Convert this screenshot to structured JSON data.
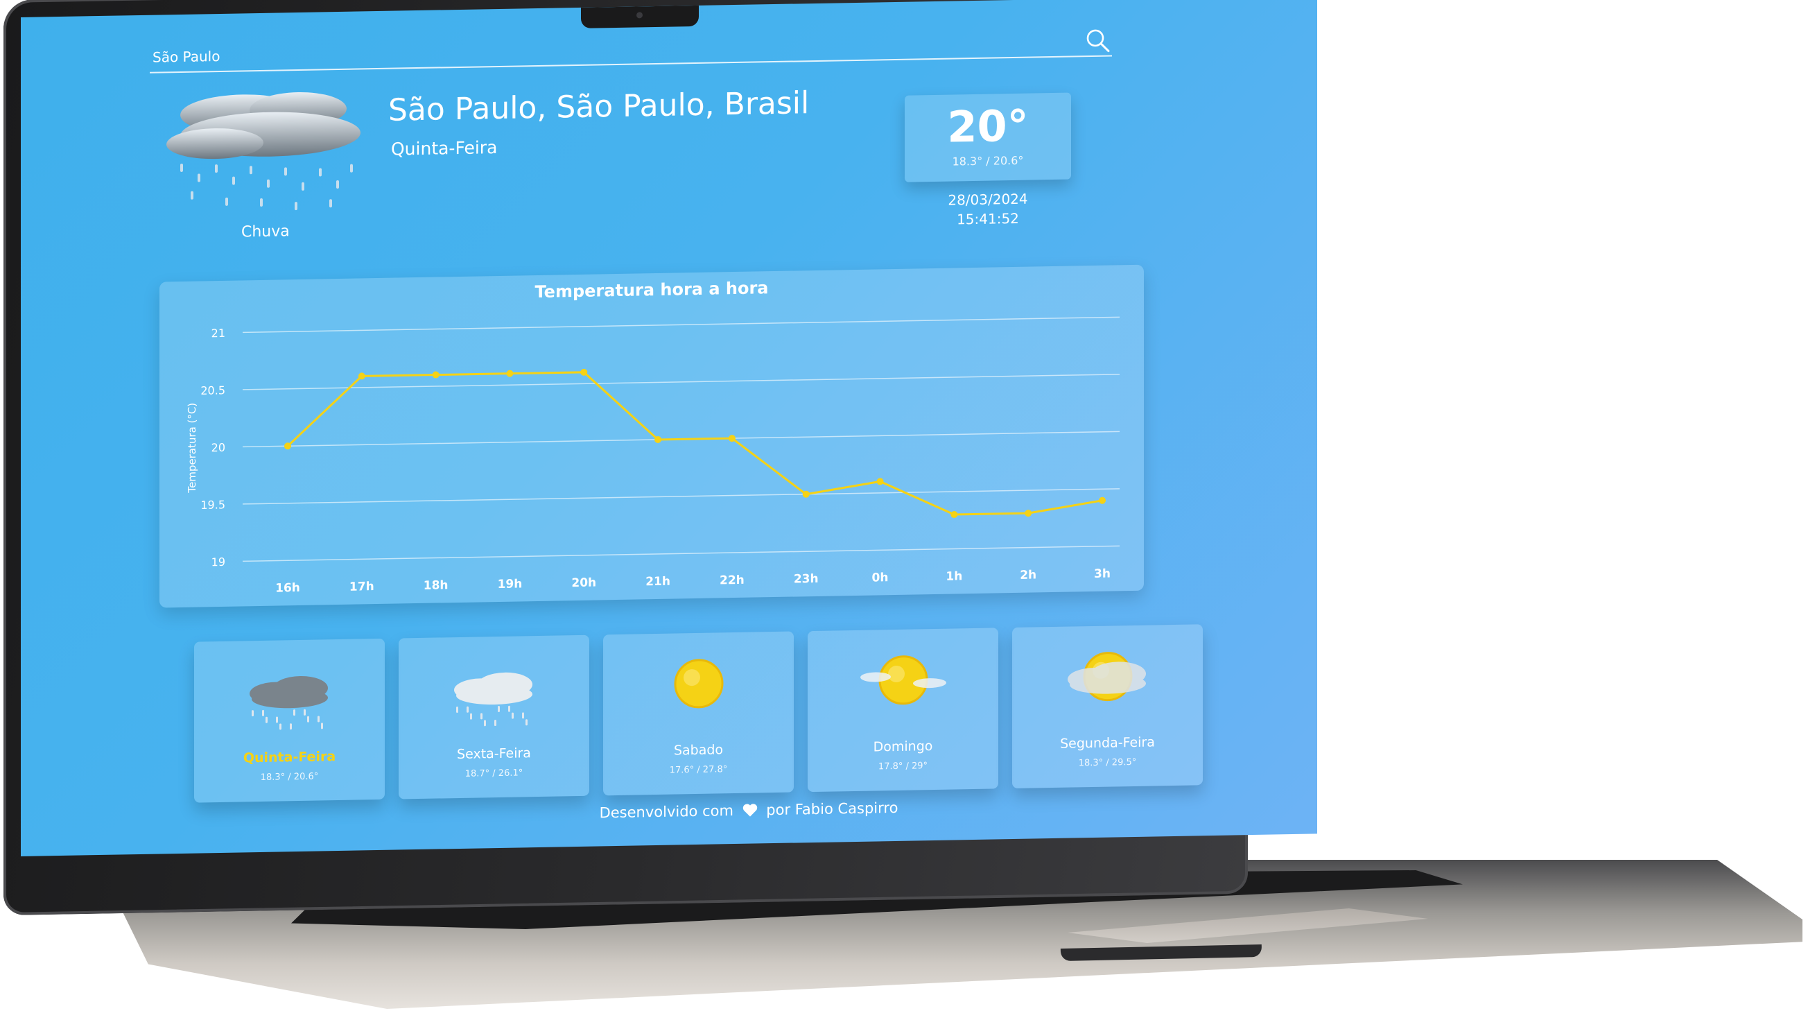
{
  "search": {
    "value": "São Paulo",
    "placeholder": ""
  },
  "current": {
    "location": "São Paulo, São Paulo, Brasil",
    "weekday": "Quinta-Feira",
    "condition": "Chuva",
    "temperature": "20°",
    "range": "18.3° / 20.6°",
    "date": "28/03/2024",
    "time": "15:41:52",
    "icon": "rain-cloud-icon"
  },
  "chart_data": {
    "type": "line",
    "title": "Temperatura hora a hora",
    "xlabel": "",
    "ylabel": "Temperatura (°C)",
    "categories": [
      "16h",
      "17h",
      "18h",
      "19h",
      "20h",
      "21h",
      "22h",
      "23h",
      "0h",
      "1h",
      "2h",
      "3h"
    ],
    "series": [
      {
        "values": [
          20.0,
          20.6,
          20.6,
          20.6,
          20.6,
          20.0,
          20.0,
          19.5,
          19.6,
          19.3,
          19.3,
          19.4
        ],
        "color": "#f5d215"
      }
    ],
    "ylim": [
      19,
      21
    ],
    "yticks": [
      "19",
      "19.5",
      "20",
      "20.5",
      "21"
    ],
    "grid": true,
    "legend": "none"
  },
  "forecast": [
    {
      "day": "Quinta-Feira",
      "range": "18.3° / 20.6°",
      "icon": "rain-cloud-icon",
      "active": true
    },
    {
      "day": "Sexta-Feira",
      "range": "18.7° / 26.1°",
      "icon": "light-rain-icon",
      "active": false
    },
    {
      "day": "Sabado",
      "range": "17.6° / 27.8°",
      "icon": "sun-icon",
      "active": false
    },
    {
      "day": "Domingo",
      "range": "17.8° / 29°",
      "icon": "sun-cloud-icon",
      "active": false
    },
    {
      "day": "Segunda-Feira",
      "range": "18.3° / 29.5°",
      "icon": "partly-cloudy-icon",
      "active": false
    }
  ],
  "footer": {
    "prefix": "Desenvolvido com",
    "suffix": "por Fabio Caspirro"
  },
  "colors": {
    "background": "#3fb0ec",
    "accent": "#f5d215",
    "text": "#ffffff"
  }
}
